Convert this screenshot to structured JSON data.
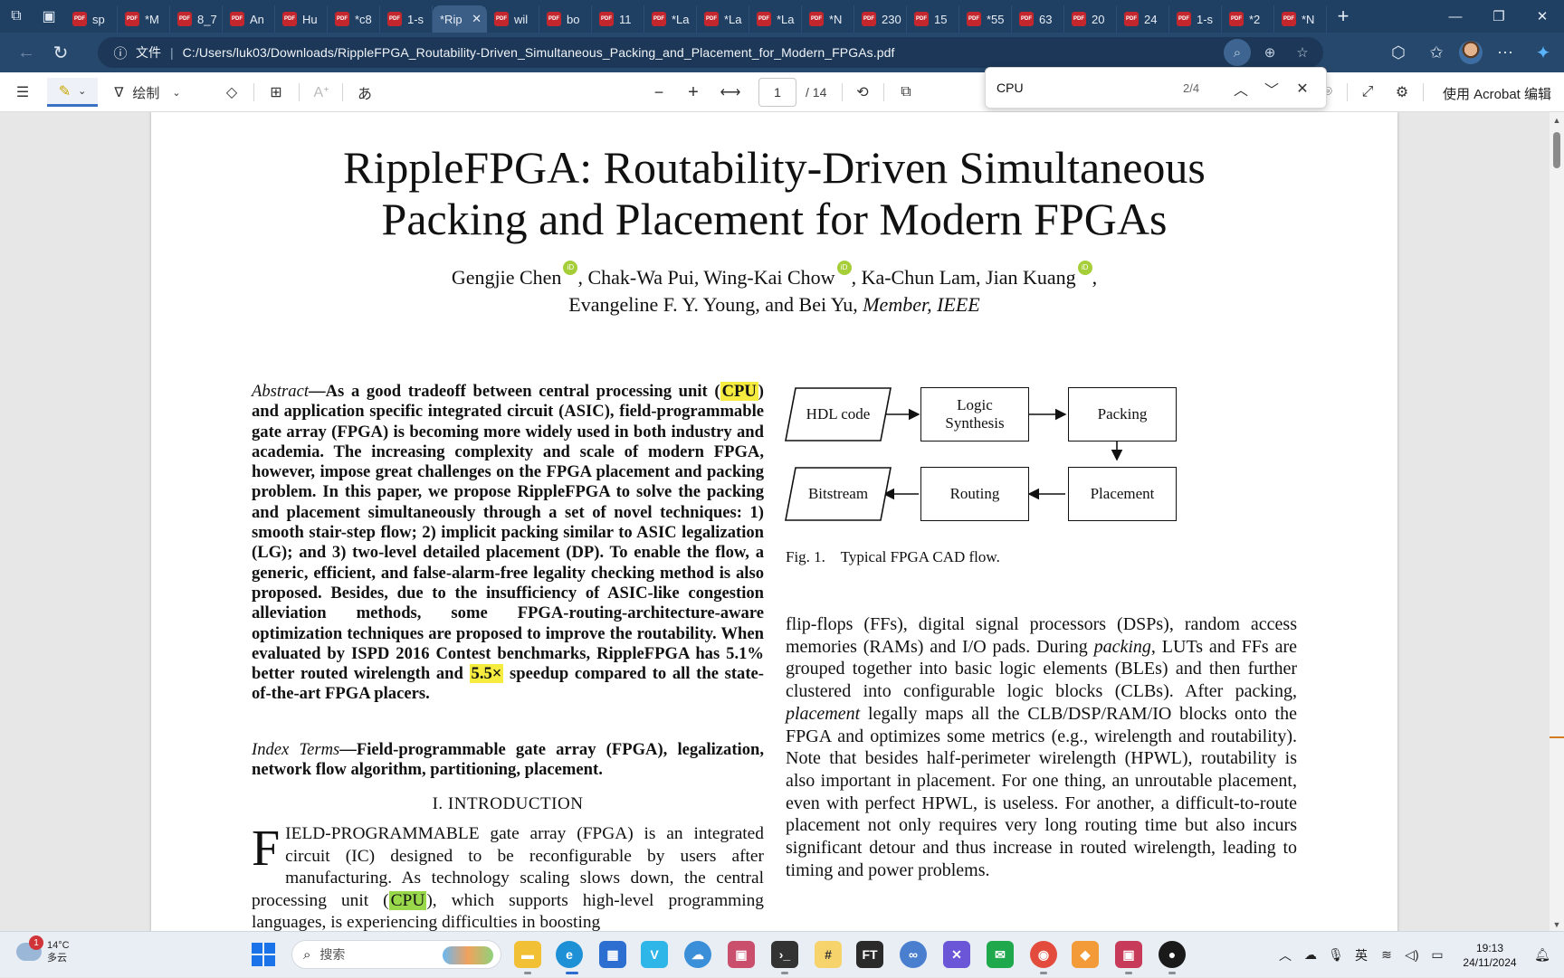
{
  "browser": {
    "tabs": [
      {
        "label": "sp"
      },
      {
        "label": "*M"
      },
      {
        "label": "8_7"
      },
      {
        "label": "An"
      },
      {
        "label": "Hu"
      },
      {
        "label": "*c8"
      },
      {
        "label": "1-s"
      },
      {
        "label": "*Rip",
        "active": true
      },
      {
        "label": "wil"
      },
      {
        "label": "bo"
      },
      {
        "label": "11"
      },
      {
        "label": "*La"
      },
      {
        "label": "*La"
      },
      {
        "label": "*La"
      },
      {
        "label": "*N"
      },
      {
        "label": "230"
      },
      {
        "label": "15"
      },
      {
        "label": "*55"
      },
      {
        "label": "63"
      },
      {
        "label": "20"
      },
      {
        "label": "24"
      },
      {
        "label": "1-s"
      },
      {
        "label": "*2"
      },
      {
        "label": "*N"
      }
    ],
    "address": {
      "file_tag": "文件",
      "separator": "|",
      "path": "C:/Users/luk03/Downloads/RippleFPGA_Routability-Driven_Simultaneous_Packing_and_Placement_for_Modern_FPGAs.pdf"
    }
  },
  "pdf_toolbar": {
    "draw_label": "绘制",
    "current_page": "1",
    "total_pages": "/ 14",
    "acrobat_edit": "使用 Acrobat 编辑"
  },
  "find": {
    "query": "CPU",
    "count": "2/4"
  },
  "document": {
    "title_line1": "RippleFPGA: Routability-Driven Simultaneous",
    "title_line2": "Packing and Placement for Modern FPGAs",
    "author1": "Gengjie Chen",
    "author2": ", Chak-Wa Pui, Wing-Kai Chow",
    "author3": ", Ka-Chun Lam, Jian Kuang",
    "author_tail": ",",
    "authors_line2": "Evangeline F. Y. Young, and Bei Yu,",
    "member": "Member, IEEE",
    "abstract_lead": "Abstract",
    "abstract_p1": "—As a good tradeoff between central processing unit (",
    "abstract_cpu": "CPU",
    "abstract_p2": ") and application specific integrated circuit (ASIC), field-programmable gate array (FPGA) is becoming more widely used in both industry and academia. The increasing complexity and scale of modern FPGA, however, impose great challenges on the FPGA placement and packing problem. In this paper, we propose RippleFPGA to solve the packing and placement simultaneously through a set of novel techniques: 1) smooth stair-step flow; 2) implicit packing similar to ASIC legalization (LG); and 3) two-level detailed placement (DP). To enable the flow, a generic, efficient, and false-alarm-free legality checking method is also proposed. Besides, due to the insufficiency of ASIC-like congestion alleviation methods, some FPGA-routing-architecture-aware optimization techniques are proposed to improve the routability. When evaluated by ISPD 2016 Contest benchmarks, RippleFPGA has 5.1% better routed wirelength and ",
    "abstract_speed": "5.5×",
    "abstract_p3": " speedup compared to all the state-of-the-art FPGA placers.",
    "index_lead": "Index Terms",
    "index_text": "—Field-programmable gate array (FPGA), legalization, network flow algorithm, partitioning, placement.",
    "section_heading": "I. INTRODUCTION",
    "intro_dropcap": "F",
    "intro_p1": "IELD-PROGRAMMABLE gate array (FPGA) is an integrated circuit (IC) designed to be reconfigurable by users after manufacturing. As technology scaling slows down, the central processing unit (",
    "intro_cpu": "CPU",
    "intro_p2": "), which supports high-level programming languages, is experiencing difficulties in boosting",
    "right_p1": "flip-flops (FFs), digital signal processors (DSPs), random access memories (RAMs) and I/O pads. During ",
    "right_packing": "packing",
    "right_p2": ", LUTs and FFs are grouped together into basic logic elements (BLEs) and then further clustered into configurable logic blocks (CLBs). After packing, ",
    "right_placement": "placement",
    "right_p3": " legally maps all the CLB/DSP/RAM/IO blocks onto the FPGA and optimizes some metrics (e.g., wirelength and routability). Note that besides half-perimeter wirelength (HPWL), routability is also important in placement. For one thing, an unroutable placement, even with perfect HPWL, is useless. For another, a difficult-to-route placement not only requires very long routing time but also incurs significant detour and thus increase in routed wirelength, leading to timing and power problems.",
    "figure": {
      "nodes": [
        "HDL code",
        "Logic Synthesis",
        "Packing",
        "Placement",
        "Routing",
        "Bitstream"
      ],
      "caption": "Fig. 1.    Typical FPGA CAD flow."
    }
  },
  "taskbar": {
    "weather_temp": "14°C",
    "weather_desc": "多云",
    "weather_badge": "1",
    "search_placeholder": "搜索",
    "ime": "英",
    "time": "19:13",
    "date": "24/11/2024"
  }
}
